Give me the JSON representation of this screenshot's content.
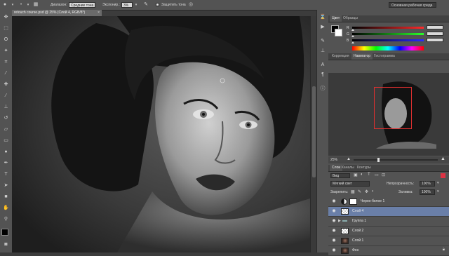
{
  "options_bar": {
    "range_label": "Диапазон:",
    "range_value": "Средние тона",
    "exposure_label": "Экспонир.:",
    "exposure_value": "3%",
    "protect_tones_label": "Защитить тона",
    "workspace_value": "Основная рабочая среда"
  },
  "document": {
    "tab_title": "retouch course.psd @ 25% (Слой 4, RGB/8*)",
    "tab_close": "×"
  },
  "tools": [
    "move-icon",
    "marquee-icon",
    "lasso-icon",
    "quick-select-icon",
    "crop-icon",
    "eyedropper-icon",
    "healing-icon",
    "brush-icon",
    "clone-stamp-icon",
    "history-brush-icon",
    "eraser-icon",
    "gradient-icon",
    "dodge-icon",
    "pen-icon",
    "type-icon",
    "path-select-icon",
    "shape-icon",
    "hand-icon",
    "zoom-icon"
  ],
  "color_panel": {
    "tabs": [
      "Цвет",
      "Образцы"
    ],
    "active_tab": 0,
    "channels": [
      {
        "label": "R",
        "gradient_color": "#ff2a2a"
      },
      {
        "label": "G",
        "gradient_color": "#2aff2a"
      },
      {
        "label": "B",
        "gradient_color": "#2a2aff"
      }
    ]
  },
  "navigator_panel": {
    "tabs": [
      "Коррекция",
      "Навигатор",
      "Гистограмма"
    ],
    "active_tab": 1,
    "zoom_value": "25%",
    "view_box_color": "#e03030"
  },
  "layers_panel": {
    "tabs": [
      "Слои",
      "Каналы",
      "Контуры"
    ],
    "active_tab": 0,
    "kind_filter": "Вид",
    "blend_mode": "Мягкий свет",
    "opacity_label": "Непрозрачность:",
    "opacity_value": "100%",
    "lock_label": "Закрепить:",
    "fill_label": "Заливка:",
    "fill_value": "100%",
    "layers": [
      {
        "name": "Черно-белое 1",
        "kind": "adjustment",
        "selected": false
      },
      {
        "name": "Слой 4",
        "kind": "empty",
        "selected": true
      },
      {
        "name": "Группа 1",
        "kind": "group",
        "selected": false
      },
      {
        "name": "Слой 2",
        "kind": "empty",
        "selected": false
      },
      {
        "name": "Слой 1",
        "kind": "photo",
        "selected": false
      },
      {
        "name": "Фон",
        "kind": "photo",
        "selected": false
      }
    ],
    "selected_color": "#6a7fa8"
  }
}
